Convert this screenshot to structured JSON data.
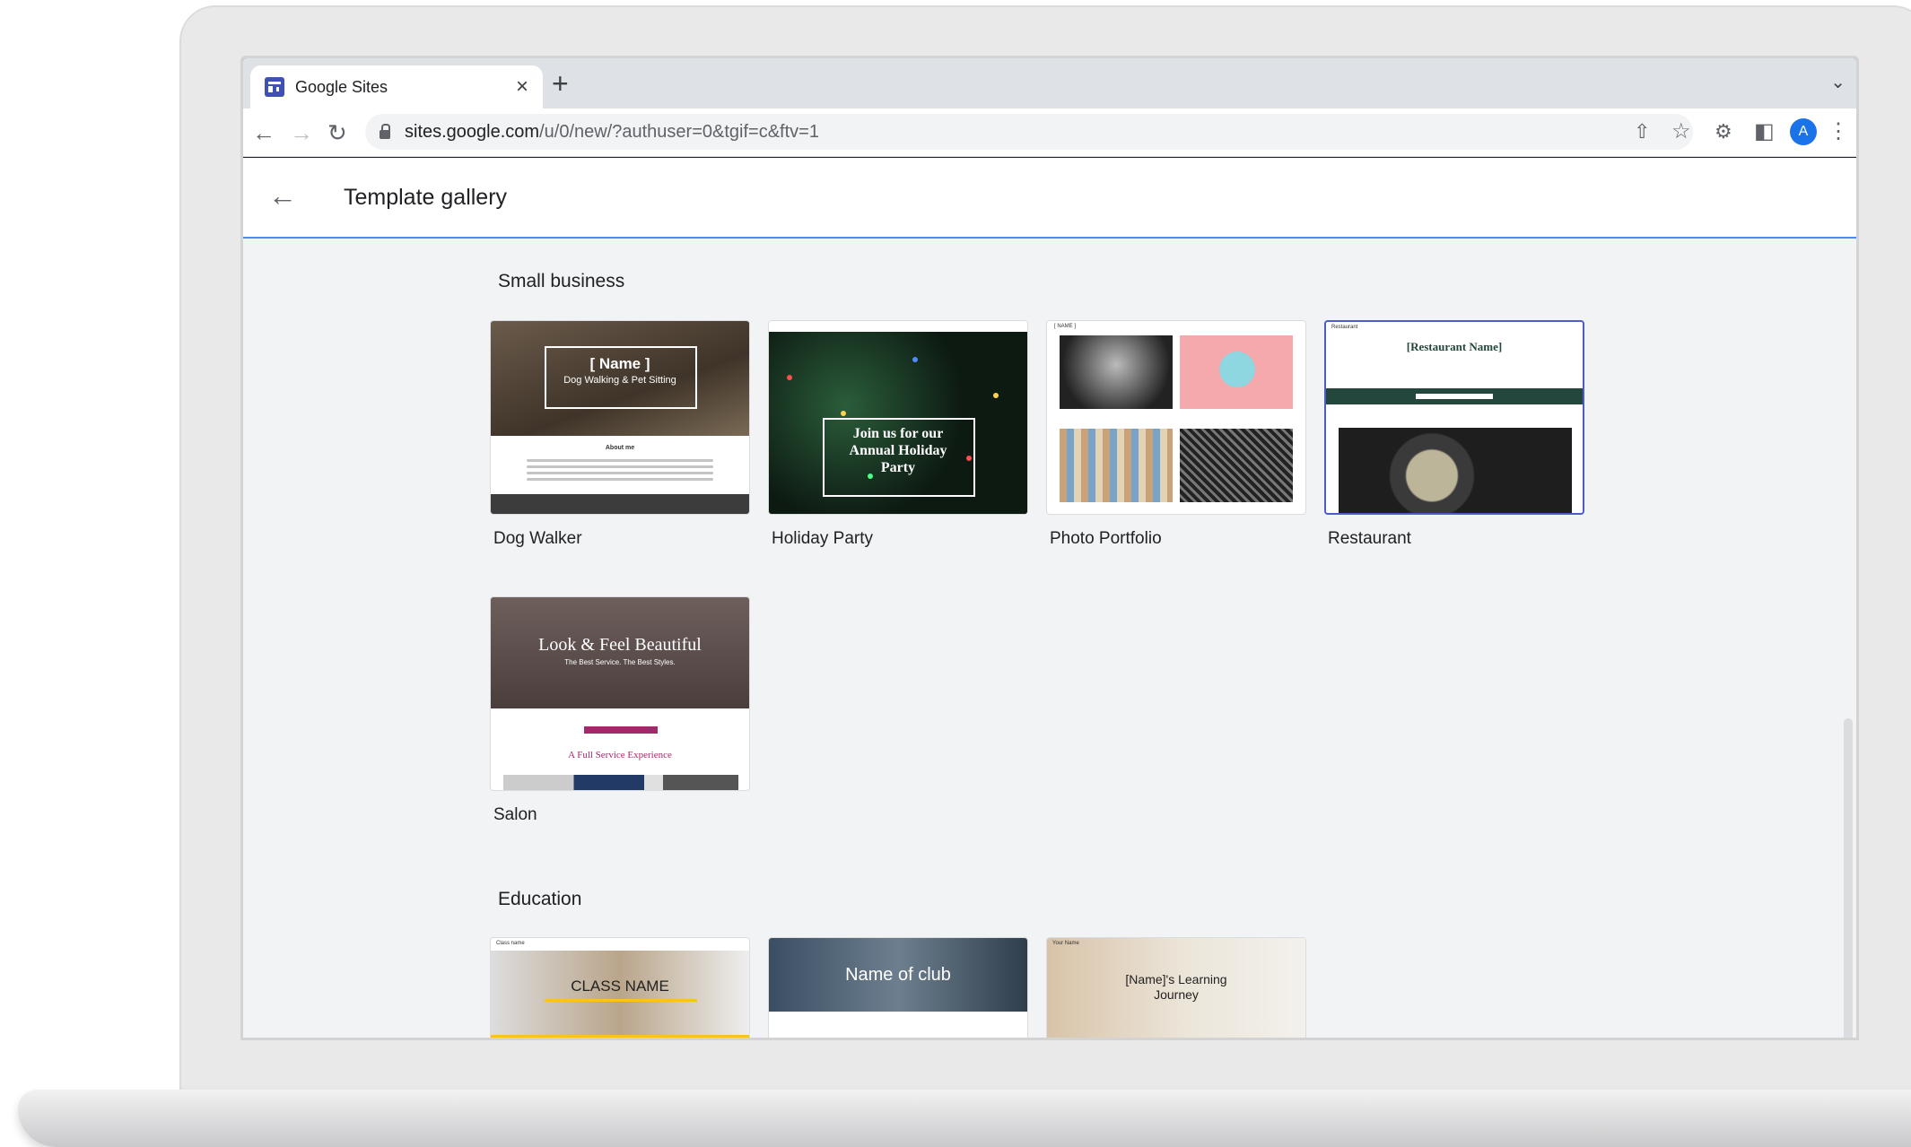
{
  "browser": {
    "tab_title": "Google Sites",
    "close_glyph": "×",
    "newtab_glyph": "+",
    "url_domain": "sites.google.com",
    "url_path": "/u/0/new/?authuser=0&tgif=c&ftv=1",
    "profile_initial": "A"
  },
  "header": {
    "title": "Template gallery"
  },
  "sections": {
    "small_business": {
      "title": "Small business",
      "cards": [
        {
          "label": "Dog Walker",
          "thumb_heading": "[ Name ]",
          "thumb_sub": "Dog Walking & Pet Sitting",
          "thumb_body": "About me"
        },
        {
          "label": "Holiday Party",
          "thumb_heading": "Join us for our Annual Holiday Party"
        },
        {
          "label": "Photo Portfolio",
          "thumb_heading": "[ NAME ]"
        },
        {
          "label": "Restaurant",
          "thumb_heading": "[Restaurant Name]",
          "thumb_brand": "Restaurant"
        },
        {
          "label": "Salon",
          "thumb_heading": "Look & Feel Beautiful",
          "thumb_sub": "The Best Service. The Best Styles.",
          "thumb_body": "A Full Service Experience"
        }
      ]
    },
    "education": {
      "title": "Education",
      "cards": [
        {
          "thumb_heading": "CLASS NAME",
          "thumb_brand": "Class name"
        },
        {
          "thumb_heading": "Name of club"
        },
        {
          "thumb_heading": "[Name]'s Learning Journey",
          "thumb_brand": "Your Name"
        }
      ]
    }
  },
  "colors": {
    "accent": "#4c8bf5",
    "restaurant_band": "#23473c",
    "salon_accent": "#a32a6a",
    "class_yellow": "#f5c518"
  }
}
